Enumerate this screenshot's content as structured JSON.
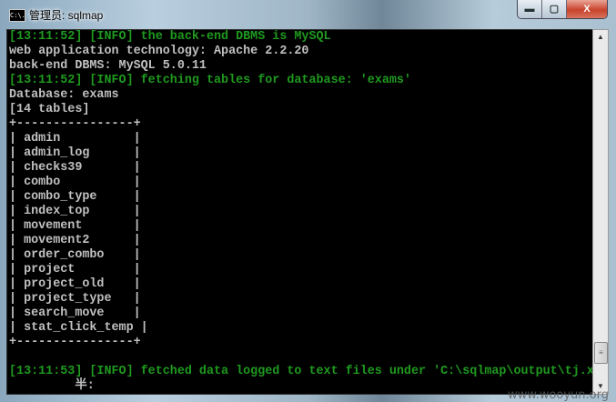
{
  "window": {
    "title": "管理员: sqlmap",
    "icon_text": "C:\\.",
    "minimize": "▬",
    "maximize": "▢",
    "close": "X"
  },
  "console": {
    "lines": [
      {
        "text": "[13:11:52] [INFO] the back-end DBMS is MySQL",
        "color": "green"
      },
      {
        "text": "web application technology: Apache 2.2.20",
        "color": "gray"
      },
      {
        "text": "back-end DBMS: MySQL 5.0.11",
        "color": "gray"
      },
      {
        "text": "[13:11:52] [INFO] fetching tables for database: 'exams'",
        "color": "green"
      },
      {
        "text": "Database: exams",
        "color": "gray"
      },
      {
        "text": "[14 tables]",
        "color": "gray"
      },
      {
        "text": "+----------------+",
        "color": "gray"
      },
      {
        "text": "| admin          |",
        "color": "gray"
      },
      {
        "text": "| admin_log      |",
        "color": "gray"
      },
      {
        "text": "| checks39       |",
        "color": "gray"
      },
      {
        "text": "| combo          |",
        "color": "gray"
      },
      {
        "text": "| combo_type     |",
        "color": "gray"
      },
      {
        "text": "| index_top      |",
        "color": "gray"
      },
      {
        "text": "| movement       |",
        "color": "gray"
      },
      {
        "text": "| movement2      |",
        "color": "gray"
      },
      {
        "text": "| order_combo    |",
        "color": "gray"
      },
      {
        "text": "| project        |",
        "color": "gray"
      },
      {
        "text": "| project_old    |",
        "color": "gray"
      },
      {
        "text": "| project_type   |",
        "color": "gray"
      },
      {
        "text": "| search_move    |",
        "color": "gray"
      },
      {
        "text": "| stat_click_temp |",
        "color": "gray"
      },
      {
        "text": "+----------------+",
        "color": "gray"
      },
      {
        "text": "",
        "color": "gray"
      },
      {
        "text": "[13:11:53] [INFO] fetched data logged to text files under 'C:\\sqlmap\\output\\tj.x",
        "color": "green"
      },
      {
        "text": "         半:",
        "color": "gray"
      }
    ]
  },
  "scrollbar": {
    "up": "▲",
    "down": "▼",
    "grip": "≡",
    "position_fraction": 0.95
  },
  "watermark": "www.wooyun.org"
}
